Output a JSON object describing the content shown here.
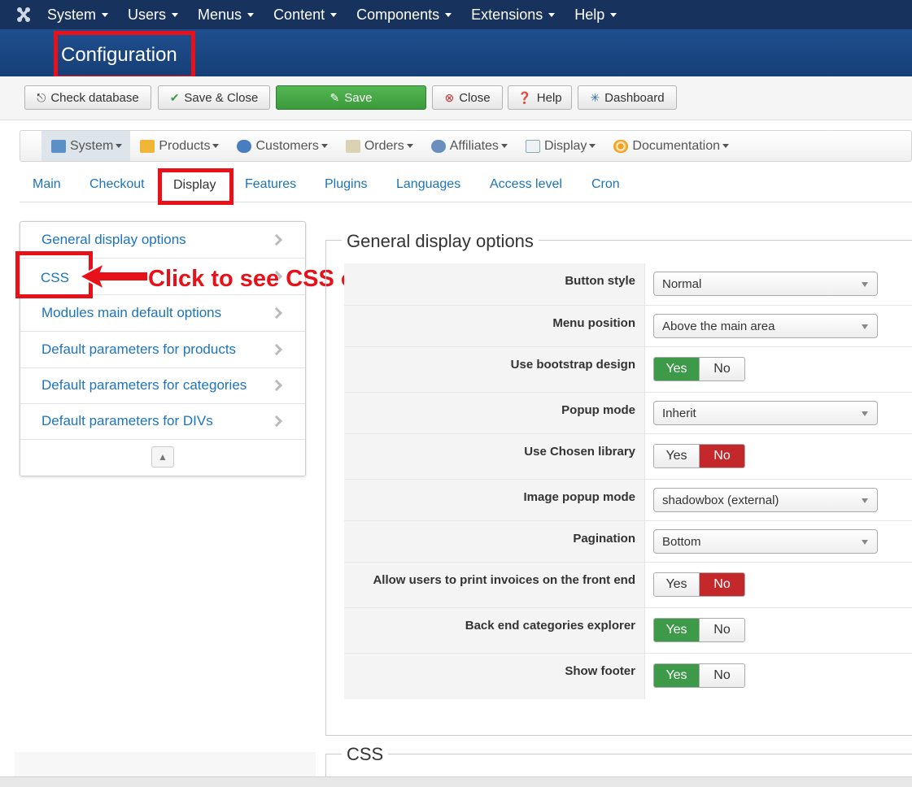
{
  "topnav": {
    "items": [
      "System",
      "Users",
      "Menus",
      "Content",
      "Components",
      "Extensions",
      "Help"
    ]
  },
  "page_title": "Configuration",
  "toolbar": {
    "check_db": "Check database",
    "save_close": "Save & Close",
    "save": "Save",
    "close": "Close",
    "help": "Help",
    "dashboard": "Dashboard"
  },
  "component_menu": {
    "items": [
      "System",
      "Products",
      "Customers",
      "Orders",
      "Affiliates",
      "Display",
      "Documentation"
    ]
  },
  "tabs": [
    "Main",
    "Checkout",
    "Display",
    "Features",
    "Plugins",
    "Languages",
    "Access level",
    "Cron"
  ],
  "left_menu": {
    "items": [
      "General display options",
      "CSS",
      "Modules main default options",
      "Default parameters for products",
      "Default parameters for categories",
      "Default parameters for DIVs"
    ]
  },
  "annotation": "Click to see CSS option",
  "section": {
    "legend": "General display options",
    "options": [
      {
        "label": "Button style",
        "type": "select",
        "value": "Normal"
      },
      {
        "label": "Menu position",
        "type": "select",
        "value": "Above the main area"
      },
      {
        "label": "Use bootstrap design",
        "type": "toggle",
        "value": "Yes"
      },
      {
        "label": "Popup mode",
        "type": "select",
        "value": "Inherit"
      },
      {
        "label": "Use Chosen library",
        "type": "toggle",
        "value": "No"
      },
      {
        "label": "Image popup mode",
        "type": "select",
        "value": "shadowbox (external)"
      },
      {
        "label": "Pagination",
        "type": "select",
        "value": "Bottom"
      },
      {
        "label": "Allow users to print invoices on the front end",
        "type": "toggle",
        "value": "No"
      },
      {
        "label": "Back end categories explorer",
        "type": "toggle",
        "value": "Yes"
      },
      {
        "label": "Show footer",
        "type": "toggle",
        "value": "Yes"
      }
    ],
    "yes": "Yes",
    "no": "No"
  },
  "section2": {
    "legend": "CSS"
  },
  "colors": {
    "topnav": "#17325c",
    "accent_red": "#e8111a",
    "link": "#1d74bb",
    "yes_green": "#3d9a48",
    "no_red": "#c4282b"
  }
}
